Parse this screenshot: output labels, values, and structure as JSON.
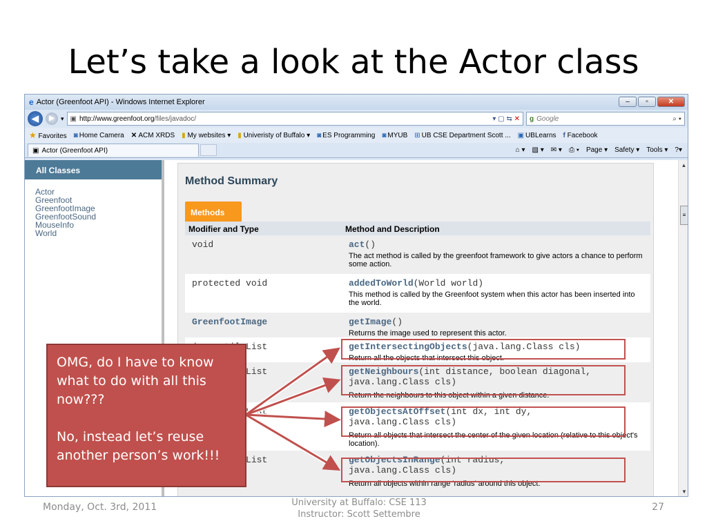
{
  "slide": {
    "title": "Let’s take a look at the Actor class",
    "callout_lines": [
      "OMG, do I have to know",
      "what to do with  all this",
      "now???",
      "",
      "No, instead let’s reuse",
      "another person’s work!!!"
    ],
    "footer_date": "Monday, Oct. 3rd, 2011",
    "footer_center_line1": "University at Buffalo: CSE 113",
    "footer_center_line2": "Instructor: Scott Settembre",
    "page_number": "27"
  },
  "browser": {
    "window_title": "Actor (Greenfoot API) - Windows Internet Explorer",
    "url_host": "http://www.greenfoot.org",
    "url_path": "/files/javadoc/",
    "search_engine": "Google",
    "favorites": [
      "Favorites",
      "Home Camera",
      "ACM XRDS",
      "My websites ▾",
      "Univeristy of Buffalo ▾",
      "ES Programming",
      "MYUB",
      "UB CSE Department Scott ...",
      "UBLearns",
      "Facebook"
    ],
    "tab_label": "Actor (Greenfoot API)",
    "command_bar": [
      "Page ▾",
      "Safety ▾",
      "Tools ▾"
    ]
  },
  "sidebar": {
    "heading": "All Classes",
    "items": [
      "Actor",
      "Greenfoot",
      "GreenfootImage",
      "GreenfootSound",
      "MouseInfo",
      "World"
    ]
  },
  "javadoc": {
    "section_title": "Method Summary",
    "tab": "Methods",
    "col_modifier": "Modifier and Type",
    "col_method": "Method and Description",
    "rows": [
      {
        "modifier": "void",
        "name": "act",
        "params": "()",
        "params2": "",
        "desc": "The act method is called by the greenfoot framework to give actors a chance to perform some action."
      },
      {
        "modifier": "protected void",
        "name": "addedToWorld",
        "params": "(World world)",
        "params2": "",
        "desc": "This method is called by the Greenfoot system when this actor has been inserted into the world."
      },
      {
        "modifier": "GreenfootImage",
        "name": "getImage",
        "params": "()",
        "params2": "",
        "desc": "Returns the image used to represent this actor."
      },
      {
        "modifier": "java.util.List",
        "name": "getIntersectingObjects",
        "params": "(java.lang.Class cls)",
        "params2": "",
        "desc": "Return all the objects that intersect this object."
      },
      {
        "modifier": "java.util.List",
        "name": "getNeighbours",
        "params": "(int distance, boolean diagonal,",
        "params2": "java.lang.Class cls)",
        "desc": "Return the neighbours to this object within a given distance."
      },
      {
        "modifier": "java.util.List",
        "name": "getObjectsAtOffset",
        "params": "(int dx, int dy,",
        "params2": "java.lang.Class cls)",
        "desc": "Return all objects that intersect the center of the given location (relative to this object's location)."
      },
      {
        "modifier": "java.util.List",
        "name": "getObjectsInRange",
        "params": "(int radius,",
        "params2": "java.lang.Class cls)",
        "desc": "Return all objects within range 'radius' around this object."
      }
    ]
  },
  "colors": {
    "accent": "#c0504d",
    "javadoc_tab": "#f8981d",
    "header_blue": "#4d7a97"
  }
}
